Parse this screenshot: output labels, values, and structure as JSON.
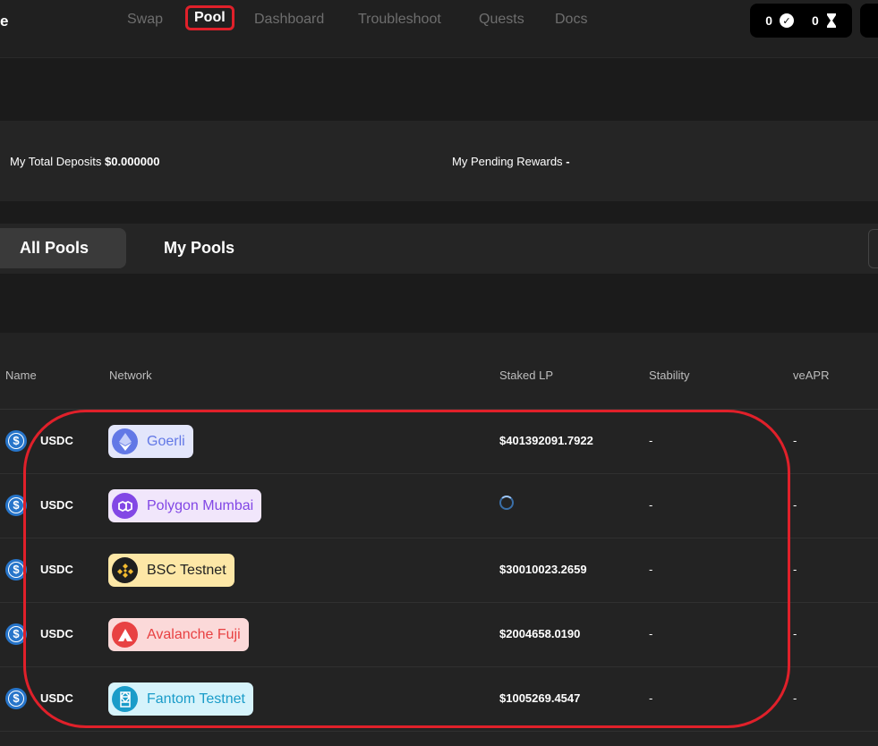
{
  "nav": {
    "brand_fragment": "e",
    "items": [
      "Swap",
      "Pool",
      "Dashboard",
      "Troubleshoot",
      "Quests",
      "Docs"
    ],
    "active": "Pool"
  },
  "counters": {
    "completed": "0",
    "pending": "0"
  },
  "stats": {
    "deposits_label": "My Total Deposits",
    "deposits_value": "$0.000000",
    "rewards_label": "My Pending Rewards",
    "rewards_value": "-"
  },
  "tabs": {
    "all": "All Pools",
    "mine": "My Pools"
  },
  "table": {
    "headers": {
      "name": "Name",
      "network": "Network",
      "staked": "Staked LP",
      "stability": "Stability",
      "apr": "veAPR"
    },
    "rows": [
      {
        "token": "USDC",
        "network": "Goerli",
        "staked": "$401392091.7922",
        "stability": "-",
        "apr": "-"
      },
      {
        "token": "USDC",
        "network": "Polygon Mumbai",
        "staked": "",
        "stability": "-",
        "apr": "-"
      },
      {
        "token": "USDC",
        "network": "BSC Testnet",
        "staked": "$30010023.2659",
        "stability": "-",
        "apr": "-"
      },
      {
        "token": "USDC",
        "network": "Avalanche Fuji",
        "staked": "$2004658.0190",
        "stability": "-",
        "apr": "-"
      },
      {
        "token": "USDC",
        "network": "Fantom Testnet",
        "staked": "$1005269.4547",
        "stability": "-",
        "apr": "-"
      }
    ]
  },
  "colors": {
    "accent_red": "#e0202a",
    "goerli_bg": "#e3e6fb",
    "goerli_fg": "#6278e6",
    "polygon_bg": "#f1e6fb",
    "polygon_fg": "#8247e5",
    "bsc_bg": "#fde7a6",
    "bsc_fg": "#222222",
    "avax_bg": "#fbd9d9",
    "avax_fg": "#e84142",
    "fantom_bg": "#d6f3fb",
    "fantom_fg": "#1a9cc9"
  }
}
